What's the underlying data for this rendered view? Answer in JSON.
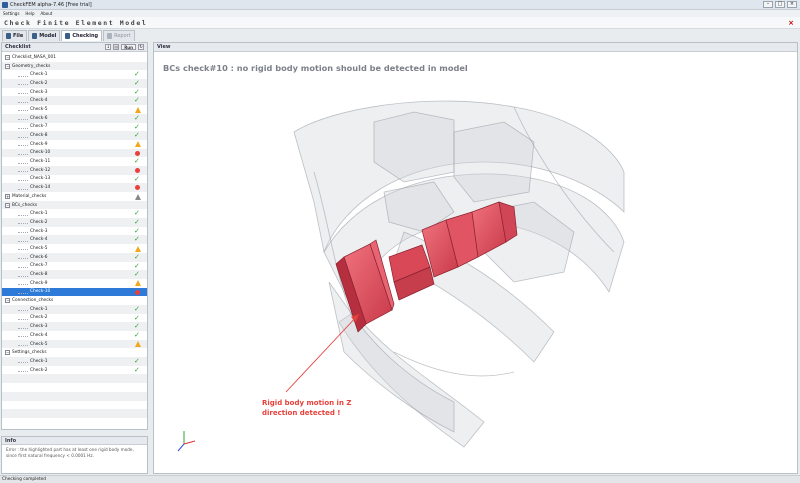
{
  "window": {
    "title": "CheckFEM alpha-7.46 [Free trial]"
  },
  "menu": [
    "Settings",
    "Help",
    "About"
  ],
  "header": {
    "title": "Check Finite Element Model"
  },
  "tabs": [
    {
      "label": "File",
      "icon": "file-icon"
    },
    {
      "label": "Model",
      "icon": "model-icon"
    },
    {
      "label": "Checking",
      "icon": "checking-icon"
    },
    {
      "label": "Report",
      "icon": "report-icon"
    }
  ],
  "checklist": {
    "title": "Checklist",
    "run_label": "Run",
    "root": "Checklist_NASA_001",
    "groups": [
      {
        "name": "Geometry_checks",
        "items": [
          {
            "label": "Check-1",
            "status": "ok"
          },
          {
            "label": "Check-2",
            "status": "ok"
          },
          {
            "label": "Check-3",
            "status": "ok"
          },
          {
            "label": "Check-4",
            "status": "ok"
          },
          {
            "label": "Check-5",
            "status": "warn"
          },
          {
            "label": "Check-6",
            "status": "ok"
          },
          {
            "label": "Check-7",
            "status": "ok"
          },
          {
            "label": "Check-8",
            "status": "ok"
          },
          {
            "label": "Check-9",
            "status": "warn"
          },
          {
            "label": "Check-10",
            "status": "err"
          },
          {
            "label": "Check-11",
            "status": "ok"
          },
          {
            "label": "Check-12",
            "status": "err"
          },
          {
            "label": "Check-13",
            "status": "ok"
          },
          {
            "label": "Check-14",
            "status": "err"
          }
        ]
      },
      {
        "name": "Material_checks",
        "collapsed": true,
        "status": "grey",
        "items": []
      },
      {
        "name": "BCs_checks",
        "items": [
          {
            "label": "Check-1",
            "status": "ok"
          },
          {
            "label": "Check-2",
            "status": "ok"
          },
          {
            "label": "Check-3",
            "status": "ok"
          },
          {
            "label": "Check-4",
            "status": "ok"
          },
          {
            "label": "Check-5",
            "status": "warn"
          },
          {
            "label": "Check-6",
            "status": "ok"
          },
          {
            "label": "Check-7",
            "status": "ok"
          },
          {
            "label": "Check-8",
            "status": "ok"
          },
          {
            "label": "Check-9",
            "status": "warn"
          },
          {
            "label": "Check-10",
            "status": "err",
            "selected": true
          }
        ]
      },
      {
        "name": "Connection_checks",
        "items": [
          {
            "label": "Check-1",
            "status": "ok"
          },
          {
            "label": "Check-2",
            "status": "ok"
          },
          {
            "label": "Check-3",
            "status": "ok"
          },
          {
            "label": "Check-4",
            "status": "ok"
          },
          {
            "label": "Check-5",
            "status": "warn"
          }
        ]
      },
      {
        "name": "Settings_checks",
        "items": [
          {
            "label": "Check-1",
            "status": "ok"
          },
          {
            "label": "Check-2",
            "status": "ok"
          }
        ]
      }
    ]
  },
  "info": {
    "title": "Info",
    "text": "Error : the highlighted part has at least one rigid body mode, since first natural frequency < 0.0001 Hz."
  },
  "view": {
    "title": "View",
    "heading": "BCs check#10 : no rigid body motion should be detected in model",
    "annotation_line1": "Rigid body motion in Z",
    "annotation_line2": "direction detected !"
  },
  "status_bar": "Checking completed",
  "colors": {
    "accent": "#2d7ad9",
    "ok": "#2fa52f",
    "warn": "#f2a81a",
    "err": "#e8413b",
    "highlight_part": "#e0505e"
  }
}
